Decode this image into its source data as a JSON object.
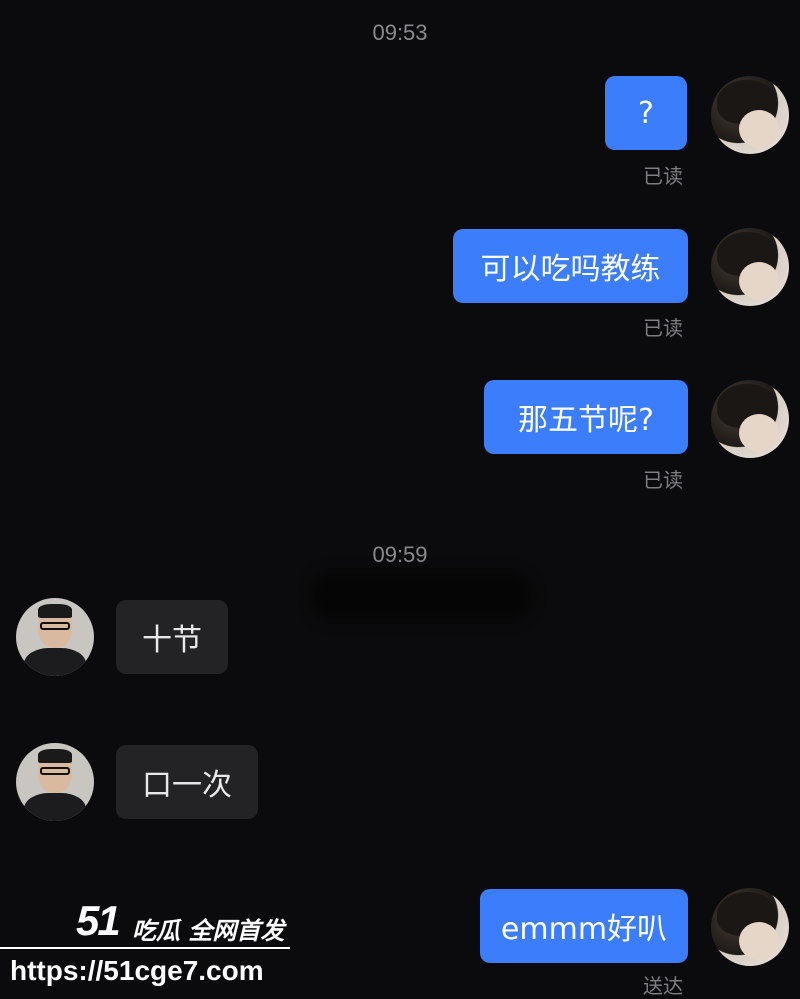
{
  "timestamps": [
    "09:53",
    "09:59"
  ],
  "messages": [
    {
      "text": "?",
      "status": "已读"
    },
    {
      "text": "可以吃吗教练",
      "status": "已读"
    },
    {
      "text": "那五节呢?",
      "status": "已读"
    },
    {
      "text": "十节"
    },
    {
      "text": "口一次"
    },
    {
      "text": "emmm好叭",
      "status": "送达"
    }
  ],
  "watermark": {
    "logo": "51",
    "tagline": "吃瓜 全网首发",
    "url": "https://51cge7.com"
  },
  "colors": {
    "background": "#0b0b0d",
    "sent_bubble": "#3b7dfb",
    "received_bubble": "#232326",
    "timestamp": "#8a8a8e",
    "status": "#7d7d82"
  }
}
